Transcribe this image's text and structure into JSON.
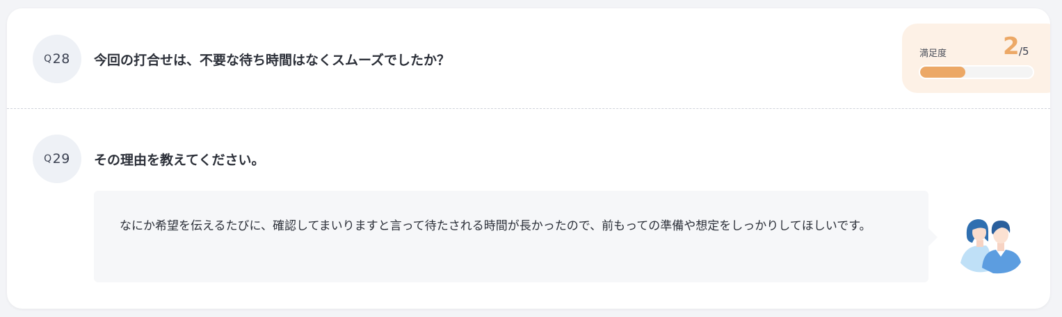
{
  "questions": [
    {
      "prefix": "Q",
      "number": "28",
      "text": "今回の打合せは、不要な待ち時間はなくスムーズでしたか？"
    },
    {
      "prefix": "Q",
      "number": "29",
      "text": "その理由を教えてください。"
    }
  ],
  "satisfaction": {
    "label": "満足度",
    "value": "2",
    "max": "/5",
    "fraction": 0.4,
    "color": "#eca866"
  },
  "answer": {
    "text": "なにか希望を伝えるたびに、確認してまいりますと言って待たされる時間が長かったので、前もっての準備や想定をしっかりしてほしいです。"
  },
  "respondent": {
    "icon": "couple-avatar-icon"
  }
}
